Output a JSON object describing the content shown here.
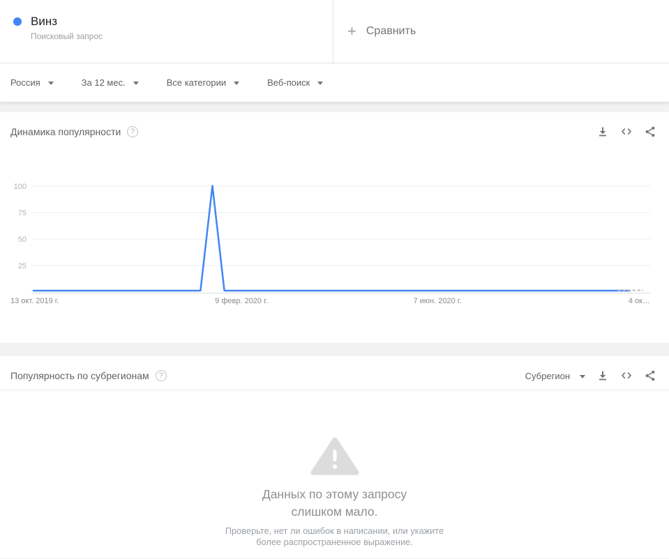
{
  "term_card": {
    "term": "Винз",
    "type_label": "Поисковый запрос",
    "dot_color": "#4285f4"
  },
  "compare": {
    "label": "Сравнить"
  },
  "filters": [
    {
      "label": "Россия"
    },
    {
      "label": "За 12 мес."
    },
    {
      "label": "Все категории"
    },
    {
      "label": "Веб-поиск"
    }
  ],
  "interest_over_time": {
    "title": "Динамика популярности"
  },
  "subregion": {
    "title": "Популярность по субрегионам",
    "dropdown_label": "Субрегион",
    "empty_state": {
      "heading": "Данных по этому запросу слишком мало.",
      "body": "Проверьте, нет ли ошибок в написании, или укажите более распространенное выражение."
    }
  },
  "icons": {
    "plus": "+",
    "help": "?",
    "caret": "▾",
    "download": "⤓",
    "embed": "<>",
    "share": "share-nodes",
    "warning": "⚠"
  },
  "colors": {
    "accent_blue": "#4285f4",
    "grid": "#ececec",
    "baseline": "#dbdde0",
    "axis_text": "#8a8a8a",
    "ytick_text": "#b3b3b3"
  },
  "chart_data": {
    "type": "line",
    "title": "Динамика популярности",
    "xlabel": "",
    "ylabel": "",
    "ylim": [
      0,
      100
    ],
    "grid": true,
    "legend_position": "none",
    "y_ticks": [
      25,
      50,
      75,
      100
    ],
    "x_tick_labels": [
      "13 окт. 2019 г.",
      "9 февр. 2020 г.",
      "7 июн. 2020 г.",
      "4 ок…"
    ],
    "x_range_note": "weekly points, 13 Oct 2019 – 4 Oct 2020",
    "series": [
      {
        "name": "Винз",
        "color": "#4285f4",
        "values": [
          1,
          1,
          1,
          1,
          1,
          1,
          1,
          1,
          1,
          1,
          1,
          1,
          1,
          1,
          1,
          100,
          1,
          1,
          1,
          1,
          1,
          1,
          1,
          1,
          1,
          1,
          1,
          1,
          1,
          1,
          1,
          1,
          1,
          1,
          1,
          1,
          1,
          1,
          1,
          1,
          1,
          1,
          1,
          1,
          1,
          1,
          1,
          1,
          1,
          1,
          1,
          1
        ]
      }
    ]
  }
}
